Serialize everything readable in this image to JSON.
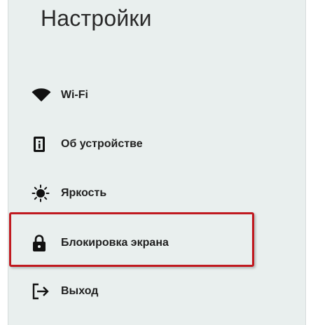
{
  "header": {
    "title": "Настройки"
  },
  "menu": {
    "items": [
      {
        "label": "Wi-Fi",
        "icon": "wifi-icon"
      },
      {
        "label": "Об устройстве",
        "icon": "info-icon"
      },
      {
        "label": "Яркость",
        "icon": "brightness-icon"
      },
      {
        "label": "Блокировка экрана",
        "icon": "lock-icon"
      },
      {
        "label": "Выход",
        "icon": "logout-icon"
      }
    ]
  },
  "colors": {
    "background": "#e9efee",
    "highlight": "#c0191f",
    "text": "#1f1f1f"
  }
}
